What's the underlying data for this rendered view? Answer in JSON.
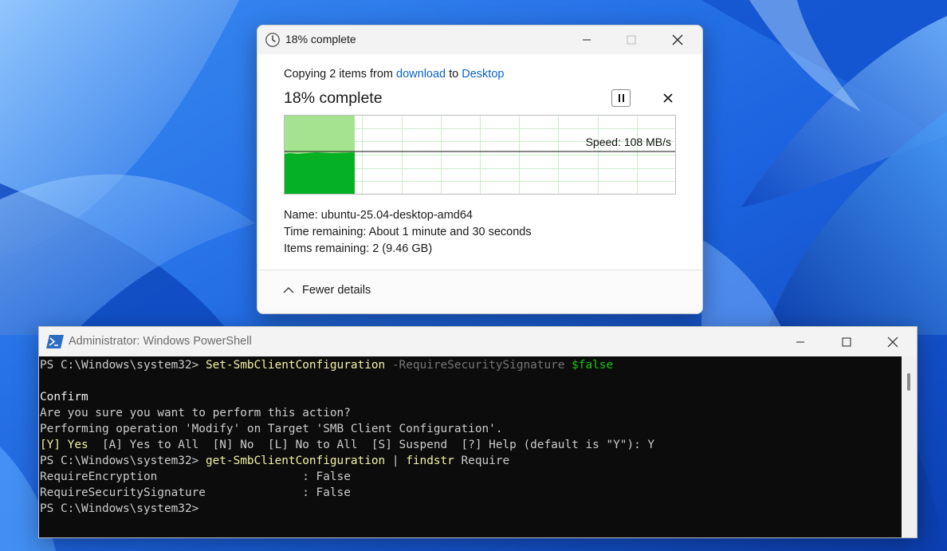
{
  "desktop": {
    "accent": "#1f6fe6"
  },
  "copy_dialog": {
    "icon": "clock-icon",
    "title": "18% complete",
    "copying_prefix": "Copying 2 items from ",
    "source": "download",
    "mid": " to ",
    "destination": "Desktop",
    "heading": "18% complete",
    "progress_fraction": 0.18,
    "speed": "Speed: 108 MB/s",
    "details": [
      {
        "label": "Name:",
        "value": "ubuntu-25.04-desktop-amd64"
      },
      {
        "label": "Time remaining:",
        "value": "About 1 minute and 30 seconds"
      },
      {
        "label": "Items remaining:",
        "value": "2 (9.46 GB)"
      }
    ],
    "fewer_details": "Fewer details",
    "colors": {
      "graph_fill": "#06b025",
      "graph_light": "#a6e391",
      "link": "#0b63c5"
    }
  },
  "powershell": {
    "icon": "powershell-icon",
    "title": "Administrator: Windows PowerShell",
    "lines": [
      [
        {
          "t": "PS C:\\Windows\\system32> ",
          "c": "default"
        },
        {
          "t": "Set-SmbClientConfiguration",
          "c": "cmd"
        },
        {
          "t": " -RequireSecuritySignature ",
          "c": "param"
        },
        {
          "t": "$false",
          "c": "var"
        }
      ],
      [
        {
          "t": "",
          "c": "default"
        }
      ],
      [
        {
          "t": "Confirm",
          "c": "white"
        }
      ],
      [
        {
          "t": "Are you sure you want to perform this action?",
          "c": "default"
        }
      ],
      [
        {
          "t": "Performing operation 'Modify' on Target 'SMB Client Configuration'.",
          "c": "default"
        }
      ],
      [
        {
          "t": "[Y] Yes  ",
          "c": "cmd"
        },
        {
          "t": "[A] Yes to All  [N] No  [L] No to All  [S] Suspend  [?] Help (default is \"Y\"): Y",
          "c": "default"
        }
      ],
      [
        {
          "t": "PS C:\\Windows\\system32> ",
          "c": "default"
        },
        {
          "t": "get-SmbClientConfiguration",
          "c": "cmd"
        },
        {
          "t": " | ",
          "c": "default"
        },
        {
          "t": "findstr",
          "c": "cmd"
        },
        {
          "t": " Require",
          "c": "default"
        }
      ],
      [
        {
          "t": "RequireEncryption                     : False",
          "c": "default"
        }
      ],
      [
        {
          "t": "RequireSecuritySignature              : False",
          "c": "default"
        }
      ],
      [
        {
          "t": "PS C:\\Windows\\system32>",
          "c": "default"
        }
      ]
    ]
  }
}
